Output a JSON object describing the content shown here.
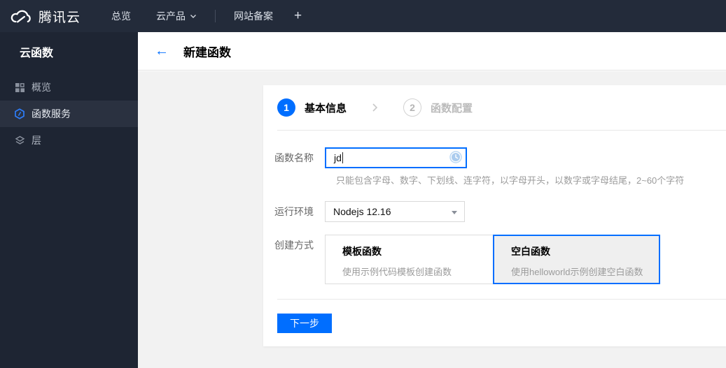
{
  "colors": {
    "accent_blue": "#006eff",
    "topbar_bg": "#232b3a",
    "sidebar_bg": "#1e2533",
    "sidebar_active_bg": "#2a3140",
    "content_bg": "#f2f2f2",
    "selected_card_bg": "#efefef"
  },
  "topbar": {
    "brand": "腾讯云",
    "nav_overview": "总览",
    "nav_products": "云产品",
    "nav_icp": "网站备案",
    "nav_plus": "+"
  },
  "sidebar": {
    "title": "云函数",
    "items": [
      {
        "label": "概览",
        "icon": "grid-icon",
        "active": false
      },
      {
        "label": "函数服务",
        "icon": "hexagon-function-icon",
        "active": true
      },
      {
        "label": "层",
        "icon": "layers-icon",
        "active": false
      }
    ]
  },
  "header": {
    "back_icon": "←",
    "title": "新建函数"
  },
  "steps": {
    "step1": {
      "number": "1",
      "label": "基本信息",
      "state": "current"
    },
    "step2": {
      "number": "2",
      "label": "函数配置",
      "state": "pending"
    }
  },
  "form": {
    "name_label": "函数名称",
    "name_value": "jd",
    "name_status_icon": "clock-pending-icon",
    "name_help": "只能包含字母、数字、下划线、连字符，以字母开头，以数字或字母结尾，2~60个字符",
    "runtime_label": "运行环境",
    "runtime_value": "Nodejs 12.16",
    "method_label": "创建方式",
    "methods": [
      {
        "title": "模板函数",
        "desc": "使用示例代码模板创建函数",
        "selected": false
      },
      {
        "title": "空白函数",
        "desc": "使用helloworld示例创建空白函数",
        "selected": true
      }
    ],
    "next_button": "下一步"
  }
}
